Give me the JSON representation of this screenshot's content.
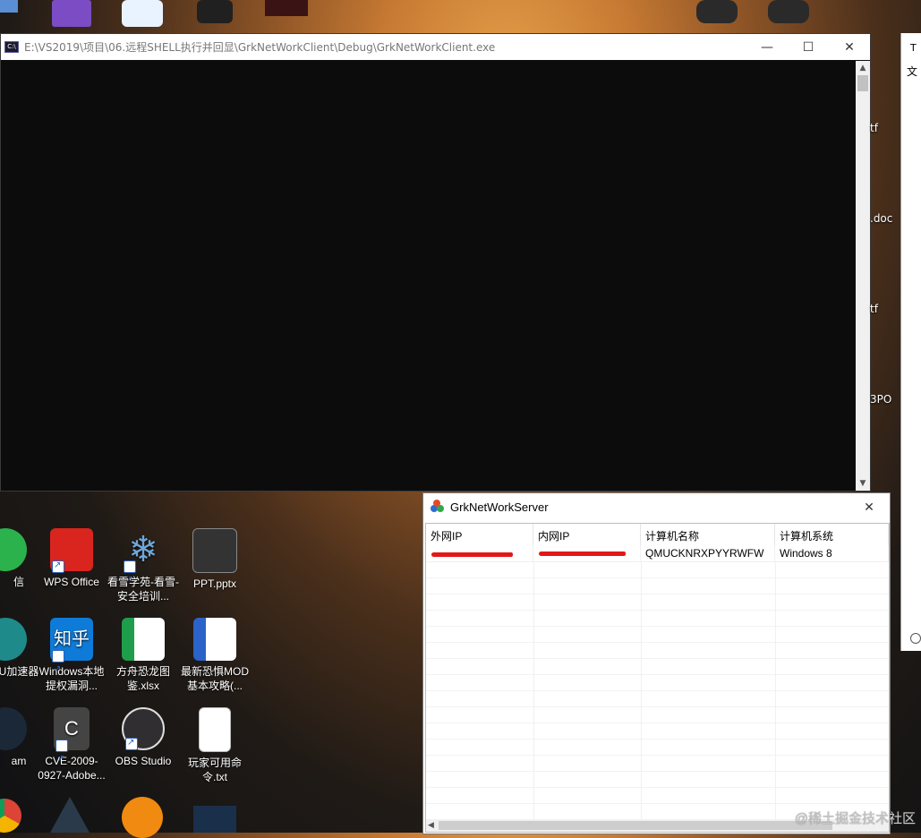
{
  "console_window": {
    "title": "E:\\VS2019\\项目\\06.远程SHELL执行并回显\\GrkNetWorkClient\\Debug\\GrkNetWorkClient.exe",
    "icon_text": "C:\\"
  },
  "window_controls": {
    "minimize": "—",
    "maximize": "☐",
    "close": "✕"
  },
  "server_window": {
    "title": "GrkNetWorkServer",
    "columns": [
      "外网IP",
      "内网IP",
      "计算机名称",
      "计算机系统"
    ],
    "rows": [
      {
        "external_ip": "",
        "internal_ip": "",
        "computer_name": "QMUCKNRXPYYRWFW",
        "os": "Windows 8"
      }
    ]
  },
  "desktop_icons": [
    {
      "label": "信",
      "color": "#2bb24c"
    },
    {
      "label": "WPS Office",
      "color": "#d9251d"
    },
    {
      "label": "看雪学苑-看雪-安全培训...",
      "color": "#2a5a8f"
    },
    {
      "label": "PPT.pptx",
      "color": "#333333"
    },
    {
      "label": "U加速器",
      "color": "#1f8a8a"
    },
    {
      "label": "Windows本地提权漏洞...",
      "color": "#0e7bd8"
    },
    {
      "label": "方舟恐龙图鉴.xlsx",
      "color": "#1e9e4a"
    },
    {
      "label": "最新恐惧MOD基本攻略(...",
      "color": "#2b63c8"
    },
    {
      "label": "am",
      "color": "#1b2838"
    },
    {
      "label": "CVE-2009-0927-Adobe...",
      "color": "#444444"
    },
    {
      "label": "OBS Studio",
      "color": "#302e31"
    },
    {
      "label": "玩家可用命令.txt",
      "color": "#ffffff"
    }
  ],
  "right_fragments": [
    "tf",
    ".doc",
    "tf",
    "3PO"
  ],
  "side_window_text": [
    "T",
    "文"
  ],
  "watermark": "@稀土掘金技术社区"
}
